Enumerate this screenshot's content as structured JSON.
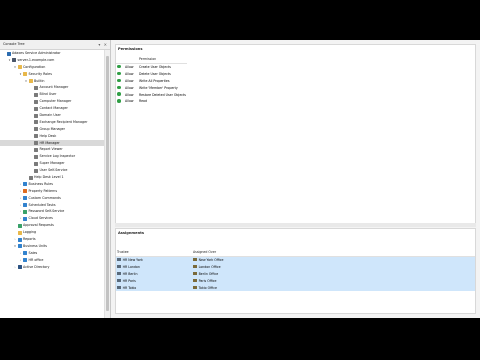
{
  "tree_panel": {
    "title": "Console Tree",
    "header_controls": "▾ ✕"
  },
  "tree": [
    {
      "label": "Adaxes Service Administrator",
      "level": 0,
      "arrow": "",
      "icon": "root"
    },
    {
      "label": "server-1.example.com",
      "level": 1,
      "arrow": "▾",
      "icon": "server"
    },
    {
      "label": "Configuration",
      "level": 2,
      "arrow": "▾",
      "icon": "folder"
    },
    {
      "label": "Security Roles",
      "level": 3,
      "arrow": "▾",
      "icon": "folder"
    },
    {
      "label": "Builtin",
      "level": 4,
      "arrow": "▾",
      "icon": "folder"
    },
    {
      "label": "Account Manager",
      "level": 5,
      "arrow": "",
      "icon": "role"
    },
    {
      "label": "Blind User",
      "level": 5,
      "arrow": "",
      "icon": "role"
    },
    {
      "label": "Computer Manager",
      "level": 5,
      "arrow": "",
      "icon": "role"
    },
    {
      "label": "Contact Manager",
      "level": 5,
      "arrow": "",
      "icon": "role"
    },
    {
      "label": "Domain User",
      "level": 5,
      "arrow": "",
      "icon": "role"
    },
    {
      "label": "Exchange Recipient Manager",
      "level": 5,
      "arrow": "",
      "icon": "role"
    },
    {
      "label": "Group Manager",
      "level": 5,
      "arrow": "",
      "icon": "role"
    },
    {
      "label": "Help Desk",
      "level": 5,
      "arrow": "",
      "icon": "role"
    },
    {
      "label": "HR Manager",
      "level": 5,
      "arrow": "",
      "icon": "role",
      "selected": true
    },
    {
      "label": "Report Viewer",
      "level": 5,
      "arrow": "",
      "icon": "role"
    },
    {
      "label": "Service Log Inspector",
      "level": 5,
      "arrow": "",
      "icon": "role"
    },
    {
      "label": "Super Manager",
      "level": 5,
      "arrow": "",
      "icon": "role"
    },
    {
      "label": "User Self-Service",
      "level": 5,
      "arrow": "",
      "icon": "role"
    },
    {
      "label": "Help Desk Level 1",
      "level": 4,
      "arrow": "",
      "icon": "role"
    },
    {
      "label": "Business Rules",
      "level": 3,
      "arrow": "›",
      "icon": "blue"
    },
    {
      "label": "Property Patterns",
      "level": 3,
      "arrow": "›",
      "icon": "orange"
    },
    {
      "label": "Custom Commands",
      "level": 3,
      "arrow": "›",
      "icon": "blue"
    },
    {
      "label": "Scheduled Tasks",
      "level": 3,
      "arrow": "›",
      "icon": "blue"
    },
    {
      "label": "Password Self-Service",
      "level": 3,
      "arrow": "›",
      "icon": "green"
    },
    {
      "label": "Cloud Services",
      "level": 3,
      "arrow": "›",
      "icon": "blue"
    },
    {
      "label": "Approval Requests",
      "level": 2,
      "arrow": "",
      "icon": "green"
    },
    {
      "label": "Logging",
      "level": 2,
      "arrow": "",
      "icon": "folder"
    },
    {
      "label": "Reports",
      "level": 2,
      "arrow": "›",
      "icon": "blue"
    },
    {
      "label": "Business Units",
      "level": 2,
      "arrow": "▾",
      "icon": "blue"
    },
    {
      "label": "Sales",
      "level": 3,
      "arrow": "›",
      "icon": "blue"
    },
    {
      "label": "HR office",
      "level": 3,
      "arrow": "›",
      "icon": "blue"
    },
    {
      "label": "Active Directory",
      "level": 2,
      "arrow": "›",
      "icon": "ad"
    }
  ],
  "permissions": {
    "title": "Permissions",
    "column_header": "Permission",
    "rows": [
      {
        "allow": "Allow",
        "permission": "Create User Objects"
      },
      {
        "allow": "Allow",
        "permission": "Delete User Objects"
      },
      {
        "allow": "Allow",
        "permission": "Write All Properties"
      },
      {
        "allow": "Allow",
        "permission": "Write 'Member' Property"
      },
      {
        "allow": "Allow",
        "permission": "Restore Deleted User Objects"
      },
      {
        "allow": "Allow",
        "permission": "Read"
      }
    ]
  },
  "assignments": {
    "title": "Assignments",
    "col_trustee": "Trustee",
    "col_assigned_over": "Assigned Over",
    "rows": [
      {
        "trustee": "HR New York",
        "assigned_over": "New York Office"
      },
      {
        "trustee": "HR London",
        "assigned_over": "London Office"
      },
      {
        "trustee": "HR Berlin",
        "assigned_over": "Berlin Office"
      },
      {
        "trustee": "HR Paris",
        "assigned_over": "Paris Office"
      },
      {
        "trustee": "HR Tokio",
        "assigned_over": "Tokio Office"
      }
    ]
  },
  "colors": {
    "selection": "#d9d9d9",
    "assignment_row": "#cfe6fb",
    "allow_check": "#2f9e44"
  }
}
